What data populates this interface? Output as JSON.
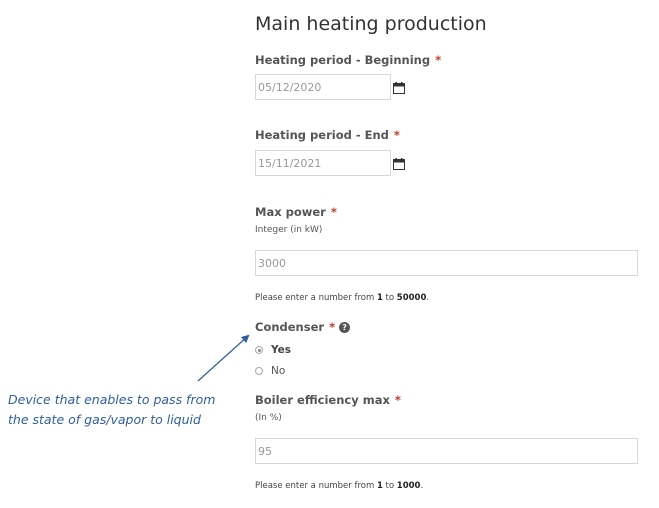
{
  "form": {
    "title": "Main heating production",
    "required_mark": "*",
    "heating_start": {
      "label": "Heating period - Beginning",
      "value": "05/12/2020"
    },
    "heating_end": {
      "label": "Heating period - End",
      "value": "15/11/2021"
    },
    "max_power": {
      "label": "Max power",
      "hint": "Integer (in kW)",
      "value": "3000",
      "help_prefix": "Please enter a number from ",
      "help_min": "1",
      "help_mid": " to ",
      "help_max": "50000",
      "help_suffix": "."
    },
    "condenser": {
      "label": "Condenser",
      "help_icon": "question-circle-icon",
      "options": [
        {
          "label": "Yes",
          "selected": true
        },
        {
          "label": "No",
          "selected": false
        }
      ]
    },
    "boiler_efficiency": {
      "label": "Boiler efficiency max",
      "hint": "(In %)",
      "value": "95",
      "help_prefix": "Please enter a number from ",
      "help_min": "1",
      "help_mid": " to ",
      "help_max": "1000",
      "help_suffix": "."
    }
  },
  "annotation": {
    "line1": "Device that enables to pass from",
    "line2": "the state of gas/vapor to liquid",
    "color": "#2f5d9e"
  }
}
